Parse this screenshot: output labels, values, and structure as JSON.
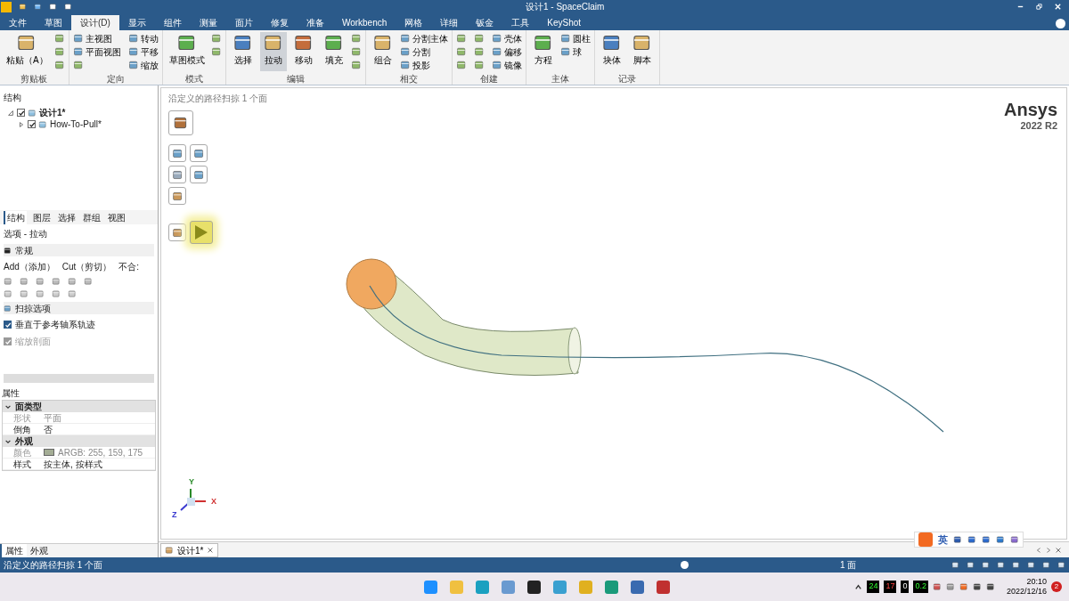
{
  "title_bar": {
    "title": "设计1 - SpaceClaim"
  },
  "menu_tabs": [
    {
      "label": "文件",
      "selected": false
    },
    {
      "label": "草图",
      "selected": false
    },
    {
      "label": "设计(D)",
      "selected": true
    },
    {
      "label": "显示",
      "selected": false
    },
    {
      "label": "组件",
      "selected": false
    },
    {
      "label": "测量",
      "selected": false
    },
    {
      "label": "面片",
      "selected": false
    },
    {
      "label": "修复",
      "selected": false
    },
    {
      "label": "准备",
      "selected": false
    },
    {
      "label": "Workbench",
      "selected": false
    },
    {
      "label": "网格",
      "selected": false
    },
    {
      "label": "详细",
      "selected": false
    },
    {
      "label": "钣金",
      "selected": false
    },
    {
      "label": "工具",
      "selected": false
    },
    {
      "label": "KeyShot",
      "selected": false
    }
  ],
  "ribbon_groups": [
    {
      "label": "剪贴板",
      "large": [
        {
          "label": "粘贴（A）",
          "selected": false
        }
      ],
      "small": [
        {
          "kind": "icon"
        },
        {
          "kind": "icon"
        },
        {
          "kind": "icon"
        }
      ]
    },
    {
      "label": "定向",
      "small": [
        {
          "kind": "labeled",
          "label": "主视图"
        },
        {
          "kind": "labeled",
          "label": "平面视图"
        },
        {
          "kind": "icon"
        },
        {
          "kind": "labeled",
          "label": "转动"
        },
        {
          "kind": "labeled",
          "label": "平移"
        },
        {
          "kind": "labeled",
          "label": "缩放"
        }
      ]
    },
    {
      "label": "模式",
      "large": [
        {
          "label": "草图模式",
          "selected": false
        }
      ],
      "small": [
        {
          "kind": "icon"
        },
        {
          "kind": "icon"
        }
      ]
    },
    {
      "label": "编辑",
      "large": [
        {
          "label": "选择",
          "selected": false
        },
        {
          "label": "拉动",
          "selected": true
        },
        {
          "label": "移动",
          "selected": false
        },
        {
          "label": "填充",
          "selected": false
        }
      ],
      "small": [
        {
          "kind": "icon"
        },
        {
          "kind": "icon"
        },
        {
          "kind": "icon"
        }
      ]
    },
    {
      "label": "相交",
      "large": [
        {
          "label": "组合",
          "selected": false
        }
      ],
      "small": [
        {
          "kind": "labeled",
          "label": "分割主体"
        },
        {
          "kind": "labeled",
          "label": "分割"
        },
        {
          "kind": "labeled",
          "label": "投影"
        }
      ]
    },
    {
      "label": "创建",
      "small": [
        {
          "kind": "icon"
        },
        {
          "kind": "icon"
        },
        {
          "kind": "icon"
        },
        {
          "kind": "icon"
        },
        {
          "kind": "icon"
        },
        {
          "kind": "icon"
        },
        {
          "kind": "labeled",
          "label": "壳体"
        },
        {
          "kind": "labeled",
          "label": "偏移"
        },
        {
          "kind": "labeled",
          "label": "镜像"
        }
      ]
    },
    {
      "label": "主体",
      "large": [
        {
          "label": "方程",
          "selected": false
        }
      ],
      "small": [
        {
          "kind": "labeled",
          "label": "圆柱"
        },
        {
          "kind": "labeled",
          "label": "球"
        }
      ]
    },
    {
      "label": "记录",
      "large": [
        {
          "label": "块体",
          "selected": false
        },
        {
          "label": "脚本",
          "selected": false
        }
      ]
    }
  ],
  "structure_panel": {
    "title": "结构",
    "tree": [
      {
        "label": "设计1*",
        "checked": true,
        "expanded": true,
        "children": [
          {
            "label": "How-To-Pull*",
            "checked": true,
            "expanded": false
          }
        ]
      }
    ]
  },
  "panel_tabs": [
    {
      "label": "结构",
      "selected": true
    },
    {
      "label": "图层",
      "selected": false
    },
    {
      "label": "选择",
      "selected": false
    },
    {
      "label": "群组",
      "selected": false
    },
    {
      "label": "视图",
      "selected": false
    }
  ],
  "options_panel": {
    "title": "选项 - 拉动",
    "section": "常规",
    "modes": [
      "Add（添加）",
      "Cut（剪切）",
      "不合:"
    ],
    "sweep_section": "扫掠选项",
    "checkboxes": [
      {
        "label": "垂直于参考轴系轨迹",
        "checked": true,
        "disabled": false
      },
      {
        "label": "缩放剖面",
        "checked": true,
        "disabled": true
      }
    ]
  },
  "properties_panel": {
    "title": "属性",
    "groups": [
      {
        "name": "面类型",
        "rows": [
          {
            "key": "形状",
            "value": "平面",
            "disabled": true
          },
          {
            "key": "倒角",
            "value": "否",
            "disabled": false
          }
        ]
      },
      {
        "name": "外观",
        "rows": [
          {
            "key": "颜色",
            "value": "ARGB: 255, 159, 175",
            "disabled": true,
            "color": "#a4ad95"
          },
          {
            "key": "样式",
            "value": "按主体, 按样式",
            "disabled": false
          }
        ]
      }
    ]
  },
  "bottom_tabs": [
    {
      "label": "属性",
      "selected": true
    },
    {
      "label": "外观",
      "selected": false
    }
  ],
  "viewport": {
    "hint": "沿定义的路径扫掠 1 个面",
    "logo": "Ansys",
    "version": "2022 R2",
    "axes": [
      "Y",
      "X",
      "Z"
    ],
    "doc_tab": "设计1*"
  },
  "ime_bar": {
    "mode": "英"
  },
  "status_bar": {
    "message": "沿定义的路径扫掠 1 个面",
    "selection": "1 面"
  },
  "taskbar": {
    "meters": [
      "24",
      "17",
      "0",
      "0.2"
    ],
    "time": "20:10",
    "date": "2022/12/16",
    "notifications": "2"
  }
}
